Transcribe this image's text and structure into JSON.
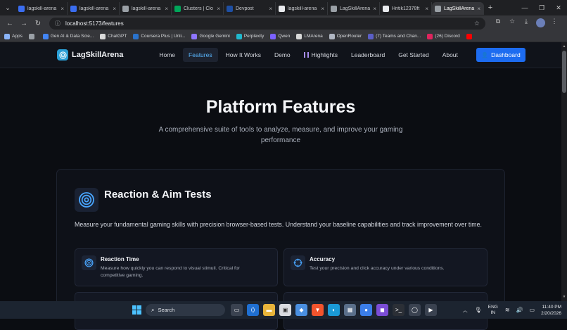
{
  "browser": {
    "tabs": [
      {
        "label": "lagskill-arena",
        "fav": "#3a6df0",
        "active": false
      },
      {
        "label": "lagskill-arena",
        "fav": "#3a6df0",
        "active": false
      },
      {
        "label": "lagskill-arena",
        "fav": "#9aa0a6",
        "active": false
      },
      {
        "label": "Clusters | Clo",
        "fav": "#00a65a",
        "active": false
      },
      {
        "label": "Devpost",
        "fav": "#1e4fa3",
        "active": false
      },
      {
        "label": "lagskill-arena",
        "fav": "#e8eaed",
        "active": false
      },
      {
        "label": "LagSkillArena",
        "fav": "#9aa0a6",
        "active": false
      },
      {
        "label": "Hritik12378ft",
        "fav": "#e8eaed",
        "active": false
      },
      {
        "label": "LagSkillArena",
        "fav": "#9aa0a6",
        "active": true
      }
    ],
    "tab_close": "×",
    "new_tab": "+",
    "address": "localhost:5173/features",
    "bookmarks": [
      {
        "label": "Apps",
        "color": "#8ab4f8"
      },
      {
        "label": "",
        "color": "#9aa0a6"
      },
      {
        "label": "Gen AI & Data Scie...",
        "color": "#4285f4"
      },
      {
        "label": "ChatGPT",
        "color": "#d9d9d9"
      },
      {
        "label": "Coursera Plus | Unli...",
        "color": "#2a73cc"
      },
      {
        "label": "Google Gemini",
        "color": "#8e75ff"
      },
      {
        "label": "Perplexity",
        "color": "#20b8cd"
      },
      {
        "label": "Qwen",
        "color": "#7b61ff"
      },
      {
        "label": "LMArena",
        "color": "#d9d9d9"
      },
      {
        "label": "OpenRouter",
        "color": "#b0b6c2"
      },
      {
        "label": "(7) Teams and Chan...",
        "color": "#5b5fc7"
      },
      {
        "label": "(26) Discord",
        "color": "#e0245e"
      },
      {
        "label": "",
        "color": "#ff0000"
      }
    ]
  },
  "app": {
    "brand": "LagSkillArena",
    "nav": [
      {
        "label": "Home",
        "active": false
      },
      {
        "label": "Features",
        "active": true
      },
      {
        "label": "How It Works",
        "active": false
      },
      {
        "label": "Demo",
        "active": false
      },
      {
        "label": "Highlights",
        "active": false
      },
      {
        "label": "Leaderboard",
        "active": false
      },
      {
        "label": "Get Started",
        "active": false
      },
      {
        "label": "About",
        "active": false
      }
    ],
    "dashboard_label": "Dashboard",
    "accent": "#1d6cf0"
  },
  "page": {
    "title": "Platform Features",
    "subtitle": "A comprehensive suite of tools to analyze, measure, and improve your gaming performance",
    "section": {
      "title": "Reaction & Aim Tests",
      "description": "Measure your fundamental gaming skills with precision browser-based tests. Understand your baseline capabilities and track improvement over time.",
      "features": [
        {
          "title": "Reaction Time",
          "description": "Measure how quickly you can respond to visual stimuli. Critical for competitive gaming.",
          "icon": "target-icon"
        },
        {
          "title": "Accuracy",
          "description": "Test your precision and click accuracy under various conditions.",
          "icon": "crosshair-icon"
        }
      ]
    }
  },
  "taskbar": {
    "search_label": "Search",
    "lang_top": "ENG",
    "lang_bottom": "IN",
    "time": "11:40 PM",
    "date": "2/20/2026"
  }
}
